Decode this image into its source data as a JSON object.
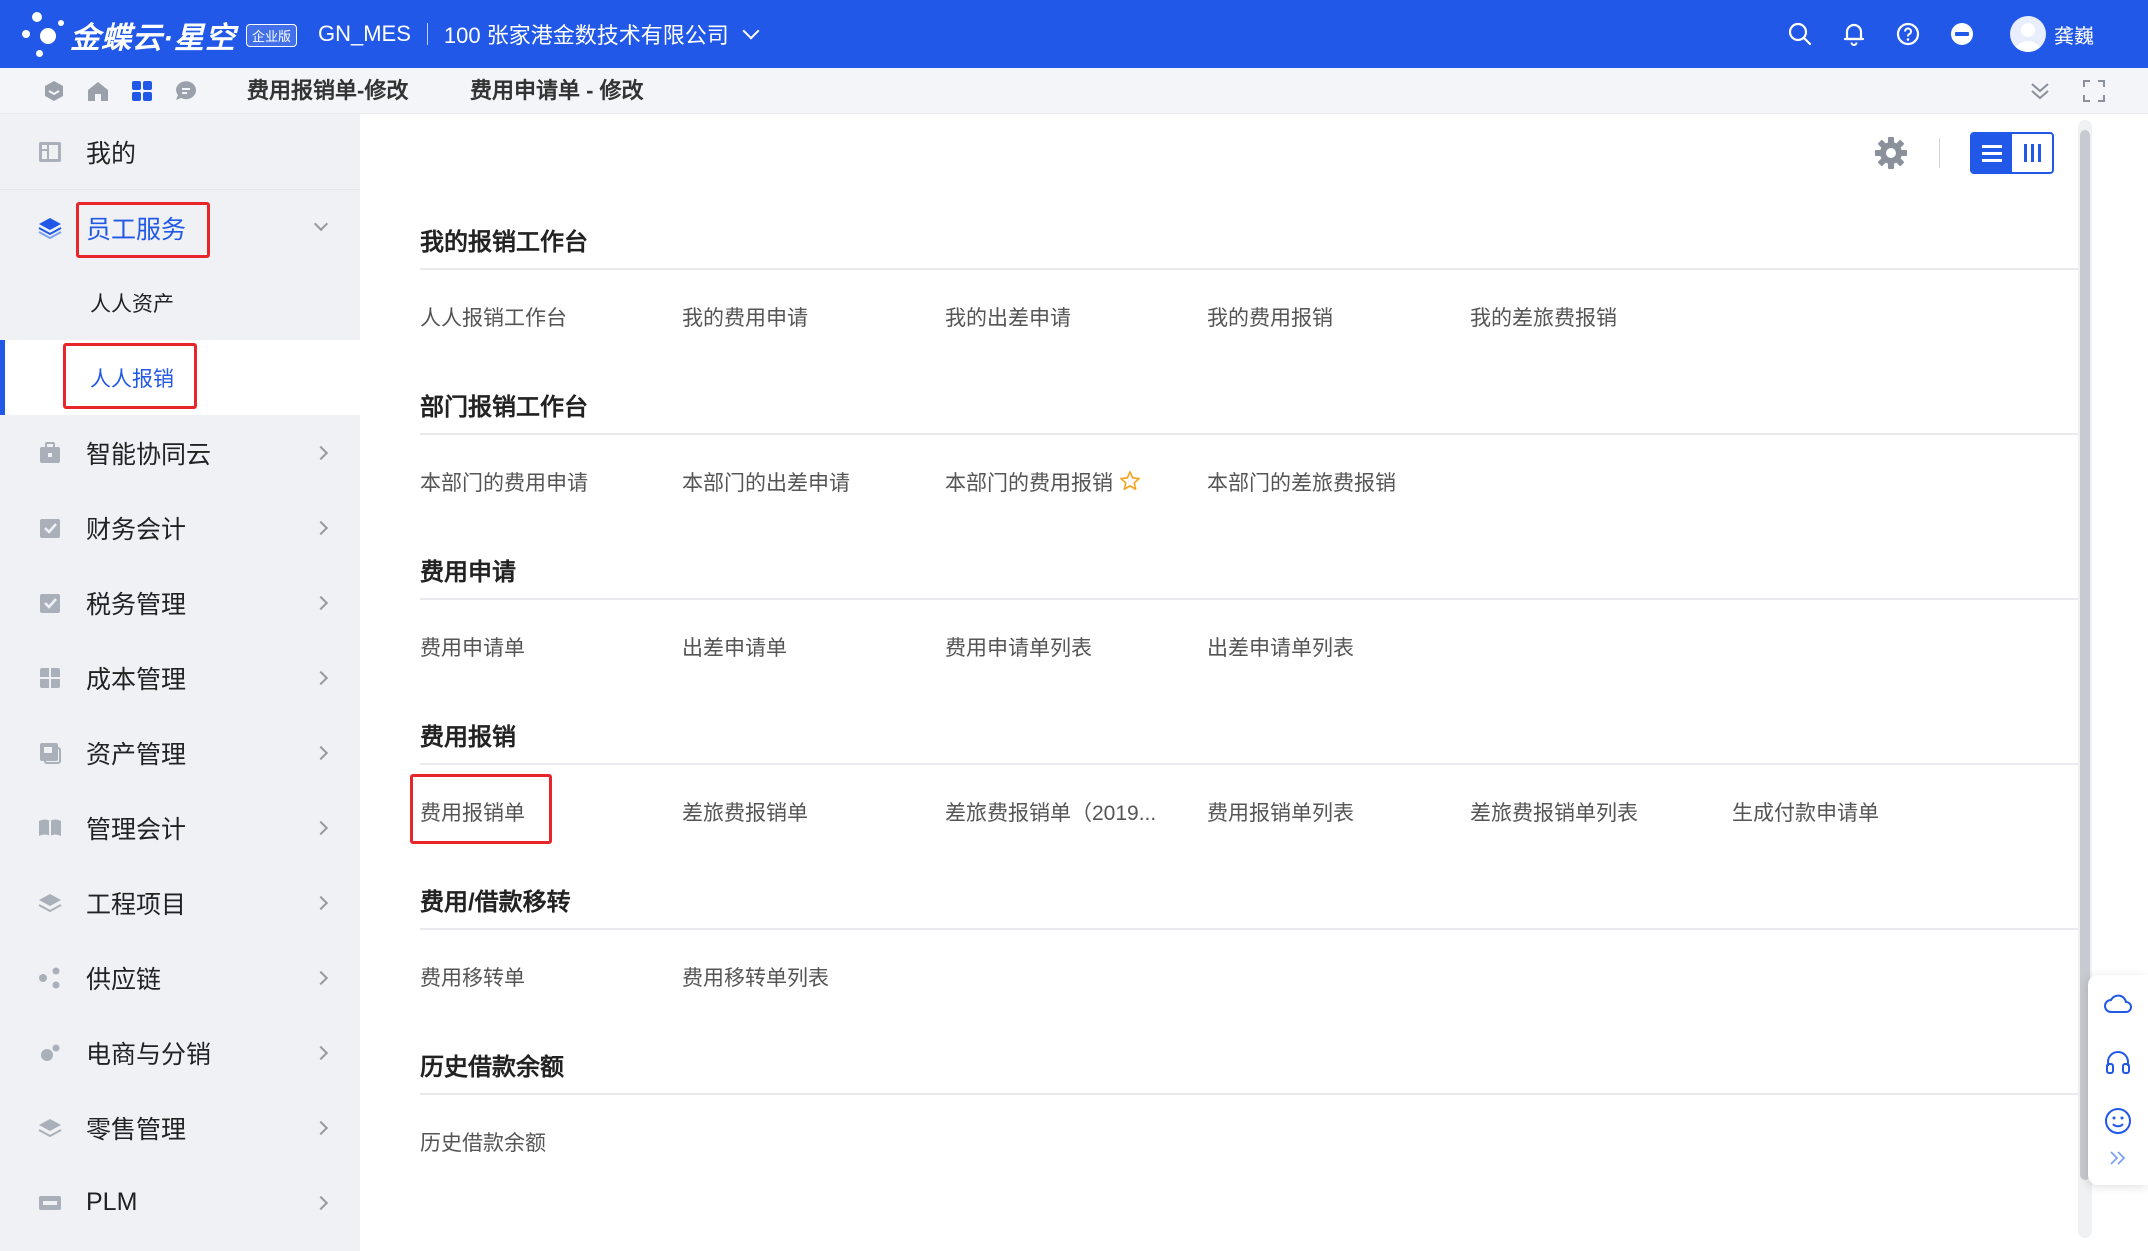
{
  "brand": {
    "name": "金蝶云·星空",
    "edition": "企业版",
    "accent": "#2158e8",
    "highlight": "#e8262a"
  },
  "header": {
    "workspace": "GN_MES",
    "company": "100 张家港金数技术有限公司",
    "icons": [
      "search-icon",
      "bell-icon",
      "help-icon",
      "minus-circle-icon"
    ],
    "user": "龚巍"
  },
  "tabs": {
    "icons": [
      "cube-icon",
      "home-icon",
      "apps-icon",
      "chat-icon"
    ],
    "items": [
      "费用报销单-修改",
      "费用申请单 - 修改"
    ]
  },
  "sidebar": {
    "my": "我的",
    "employee_services": "员工服务",
    "sub": [
      "人人资产",
      "人人报销"
    ],
    "items": [
      "智能协同云",
      "财务会计",
      "税务管理",
      "成本管理",
      "资产管理",
      "管理会计",
      "工程项目",
      "供应链",
      "电商与分销",
      "零售管理",
      "PLM"
    ]
  },
  "sections": [
    {
      "title": "我的报销工作台",
      "links": [
        "人人报销工作台",
        "我的费用申请",
        "我的出差申请",
        "我的费用报销",
        "我的差旅费报销"
      ]
    },
    {
      "title": "部门报销工作台",
      "links": [
        "本部门的费用申请",
        "本部门的出差申请",
        "本部门的费用报销",
        "本部门的差旅费报销"
      ]
    },
    {
      "title": "费用申请",
      "links": [
        "费用申请单",
        "出差申请单",
        "费用申请单列表",
        "出差申请单列表"
      ]
    },
    {
      "title": "费用报销",
      "links": [
        "费用报销单",
        "差旅费报销单",
        "差旅费报销单（2019...",
        "费用报销单列表",
        "差旅费报销单列表",
        "生成付款申请单"
      ]
    },
    {
      "title": "费用/借款移转",
      "links": [
        "费用移转单",
        "费用移转单列表"
      ]
    },
    {
      "title": "历史借款余额",
      "links": [
        "历史借款余额"
      ]
    }
  ]
}
